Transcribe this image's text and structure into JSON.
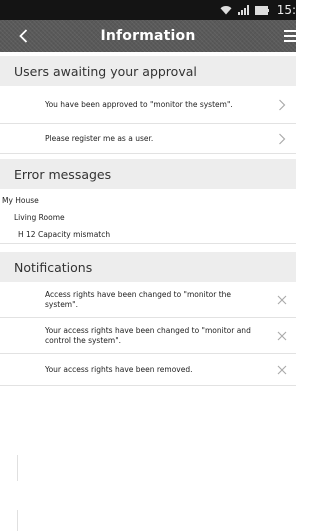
{
  "status_bar": {
    "time": "15:"
  },
  "header": {
    "title": "Information"
  },
  "sections": {
    "approval": {
      "title": "Users awaiting your approval",
      "items": [
        {
          "text": "You have been approved to \"monitor the system\"."
        },
        {
          "text": "Please register me as a user."
        }
      ]
    },
    "errors": {
      "title": "Error messages",
      "tree": {
        "level0": "My House",
        "level1": "Living Roome",
        "level2": "H 12 Capacity mismatch"
      }
    },
    "notifications": {
      "title": "Notifications",
      "items": [
        {
          "text": "Access rights have been changed to \"monitor the system\"."
        },
        {
          "text": "Your access rights have been changed to \"monitor and control the system\"."
        },
        {
          "text": "Your access rights have been removed."
        }
      ]
    }
  }
}
